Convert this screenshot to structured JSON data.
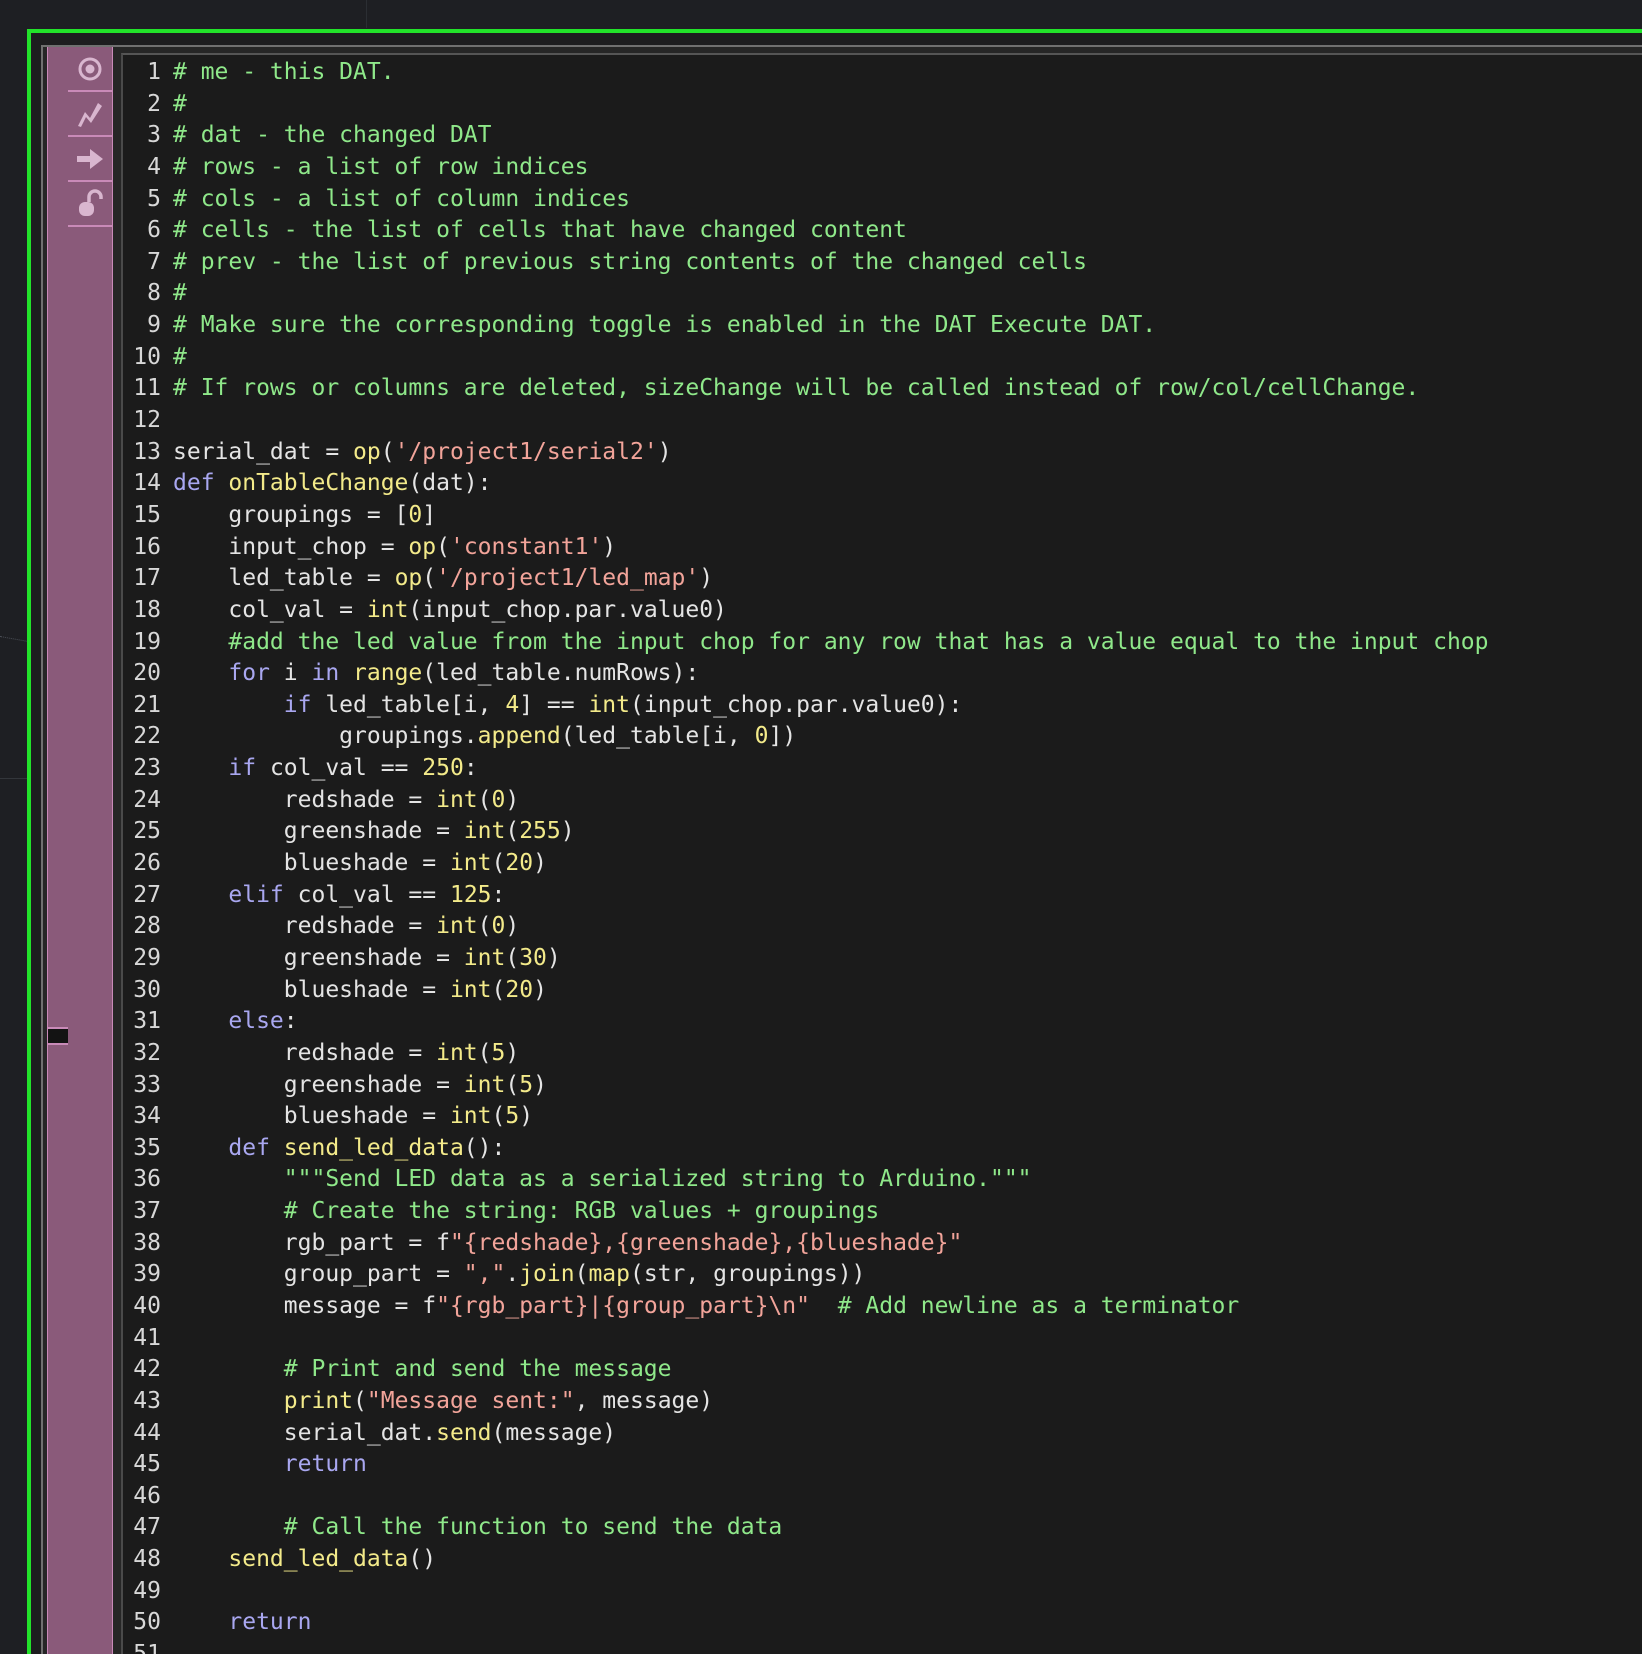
{
  "editor": {
    "title": "DAT Execute DAT",
    "lines": [
      [
        [
          "c",
          "# me - this DAT."
        ]
      ],
      [
        [
          "c",
          "#"
        ]
      ],
      [
        [
          "c",
          "# dat - the changed DAT"
        ]
      ],
      [
        [
          "c",
          "# rows - a list of row indices"
        ]
      ],
      [
        [
          "c",
          "# cols - a list of column indices"
        ]
      ],
      [
        [
          "c",
          "# cells - the list of cells that have changed content"
        ]
      ],
      [
        [
          "c",
          "# prev - the list of previous string contents of the changed cells"
        ]
      ],
      [
        [
          "c",
          "#"
        ]
      ],
      [
        [
          "c",
          "# Make sure the corresponding toggle is enabled in the DAT Execute DAT."
        ]
      ],
      [
        [
          "c",
          "#"
        ]
      ],
      [
        [
          "c",
          "# If rows or columns are deleted, sizeChange will be called instead of row/col/cellChange."
        ]
      ],
      [],
      [
        [
          "t",
          "serial_dat = "
        ],
        [
          "f",
          "op"
        ],
        [
          "t",
          "("
        ],
        [
          "s",
          "'/project1/serial2'"
        ],
        [
          "t",
          ")"
        ]
      ],
      [
        [
          "k",
          "def "
        ],
        [
          "f",
          "onTableChange"
        ],
        [
          "t",
          "(dat):"
        ]
      ],
      [
        [
          "t",
          "    groupings = ["
        ],
        [
          "n",
          "0"
        ],
        [
          "t",
          "]"
        ]
      ],
      [
        [
          "t",
          "    input_chop = "
        ],
        [
          "f",
          "op"
        ],
        [
          "t",
          "("
        ],
        [
          "s",
          "'constant1'"
        ],
        [
          "t",
          ")"
        ]
      ],
      [
        [
          "t",
          "    led_table = "
        ],
        [
          "f",
          "op"
        ],
        [
          "t",
          "("
        ],
        [
          "s",
          "'/project1/led_map'"
        ],
        [
          "t",
          ")"
        ]
      ],
      [
        [
          "t",
          "    col_val = "
        ],
        [
          "f",
          "int"
        ],
        [
          "t",
          "(input_chop.par.value0)"
        ]
      ],
      [
        [
          "c",
          "    #add the led value from the input chop for any row that has a value equal to the input chop"
        ]
      ],
      [
        [
          "t",
          "    "
        ],
        [
          "k",
          "for "
        ],
        [
          "t",
          "i "
        ],
        [
          "k",
          "in "
        ],
        [
          "f",
          "range"
        ],
        [
          "t",
          "(led_table.numRows):"
        ]
      ],
      [
        [
          "t",
          "        "
        ],
        [
          "k",
          "if "
        ],
        [
          "t",
          "led_table[i, "
        ],
        [
          "n",
          "4"
        ],
        [
          "t",
          "] == "
        ],
        [
          "f",
          "int"
        ],
        [
          "t",
          "(input_chop.par.value0):"
        ]
      ],
      [
        [
          "t",
          "            groupings."
        ],
        [
          "f",
          "append"
        ],
        [
          "t",
          "(led_table[i, "
        ],
        [
          "n",
          "0"
        ],
        [
          "t",
          "])"
        ]
      ],
      [
        [
          "t",
          "    "
        ],
        [
          "k",
          "if "
        ],
        [
          "t",
          "col_val == "
        ],
        [
          "n",
          "250"
        ],
        [
          "t",
          ":"
        ]
      ],
      [
        [
          "t",
          "        redshade = "
        ],
        [
          "f",
          "int"
        ],
        [
          "t",
          "("
        ],
        [
          "n",
          "0"
        ],
        [
          "t",
          ")"
        ]
      ],
      [
        [
          "t",
          "        greenshade = "
        ],
        [
          "f",
          "int"
        ],
        [
          "t",
          "("
        ],
        [
          "n",
          "255"
        ],
        [
          "t",
          ")"
        ]
      ],
      [
        [
          "t",
          "        blueshade = "
        ],
        [
          "f",
          "int"
        ],
        [
          "t",
          "("
        ],
        [
          "n",
          "20"
        ],
        [
          "t",
          ")"
        ]
      ],
      [
        [
          "t",
          "    "
        ],
        [
          "k",
          "elif "
        ],
        [
          "t",
          "col_val == "
        ],
        [
          "n",
          "125"
        ],
        [
          "t",
          ":"
        ]
      ],
      [
        [
          "t",
          "        redshade = "
        ],
        [
          "f",
          "int"
        ],
        [
          "t",
          "("
        ],
        [
          "n",
          "0"
        ],
        [
          "t",
          ")"
        ]
      ],
      [
        [
          "t",
          "        greenshade = "
        ],
        [
          "f",
          "int"
        ],
        [
          "t",
          "("
        ],
        [
          "n",
          "30"
        ],
        [
          "t",
          ")"
        ]
      ],
      [
        [
          "t",
          "        blueshade = "
        ],
        [
          "f",
          "int"
        ],
        [
          "t",
          "("
        ],
        [
          "n",
          "20"
        ],
        [
          "t",
          ")"
        ]
      ],
      [
        [
          "t",
          "    "
        ],
        [
          "k",
          "else"
        ],
        [
          "t",
          ":"
        ]
      ],
      [
        [
          "t",
          "        redshade = "
        ],
        [
          "f",
          "int"
        ],
        [
          "t",
          "("
        ],
        [
          "n",
          "5"
        ],
        [
          "t",
          ")"
        ]
      ],
      [
        [
          "t",
          "        greenshade = "
        ],
        [
          "f",
          "int"
        ],
        [
          "t",
          "("
        ],
        [
          "n",
          "5"
        ],
        [
          "t",
          ")"
        ]
      ],
      [
        [
          "t",
          "        blueshade = "
        ],
        [
          "f",
          "int"
        ],
        [
          "t",
          "("
        ],
        [
          "n",
          "5"
        ],
        [
          "t",
          ")"
        ]
      ],
      [
        [
          "t",
          "    "
        ],
        [
          "k",
          "def "
        ],
        [
          "f",
          "send_led_data"
        ],
        [
          "t",
          "():"
        ]
      ],
      [
        [
          "t",
          "        "
        ],
        [
          "c",
          "\"\"\"Send LED data as a serialized string to Arduino.\"\"\""
        ]
      ],
      [
        [
          "t",
          "        "
        ],
        [
          "c",
          "# Create the string: RGB values + groupings"
        ]
      ],
      [
        [
          "t",
          "        rgb_part = f"
        ],
        [
          "s",
          "\"{redshade},{greenshade},{blueshade}\""
        ]
      ],
      [
        [
          "t",
          "        group_part = "
        ],
        [
          "s",
          "\",\""
        ],
        [
          "t",
          "."
        ],
        [
          "f",
          "join"
        ],
        [
          "t",
          "("
        ],
        [
          "f",
          "map"
        ],
        [
          "t",
          "(str, groupings))"
        ]
      ],
      [
        [
          "t",
          "        message = f"
        ],
        [
          "s",
          "\"{rgb_part}|{group_part}\\n\""
        ],
        [
          "t",
          "  "
        ],
        [
          "c",
          "# Add newline as a terminator"
        ]
      ],
      [],
      [
        [
          "t",
          "        "
        ],
        [
          "c",
          "# Print and send the message"
        ]
      ],
      [
        [
          "t",
          "        "
        ],
        [
          "f",
          "print"
        ],
        [
          "t",
          "("
        ],
        [
          "s",
          "\"Message sent:\""
        ],
        [
          "t",
          ", message)"
        ]
      ],
      [
        [
          "t",
          "        serial_dat."
        ],
        [
          "f",
          "send"
        ],
        [
          "t",
          "(message)"
        ]
      ],
      [
        [
          "t",
          "        "
        ],
        [
          "k",
          "return"
        ]
      ],
      [],
      [
        [
          "t",
          "        "
        ],
        [
          "c",
          "# Call the function to send the data"
        ]
      ],
      [
        [
          "t",
          "    "
        ],
        [
          "f",
          "send_led_data"
        ],
        [
          "t",
          "()"
        ]
      ],
      [],
      [
        [
          "t",
          "    "
        ],
        [
          "k",
          "return"
        ]
      ],
      []
    ]
  },
  "toolbar": {
    "buttons": [
      {
        "icon": "viewer-active-icon"
      },
      {
        "icon": "cook-flag-icon"
      },
      {
        "icon": "export-arrow-icon"
      },
      {
        "icon": "lock-icon"
      }
    ]
  },
  "colors": {
    "frame_border": "#22e22a",
    "toolbar_bg": "#8a5a7a",
    "editor_bg": "#1b1b1b",
    "comment": "#8fe88a",
    "keyword": "#a9a7f0",
    "string": "#f2a49a",
    "function": "#f3ea8a"
  }
}
